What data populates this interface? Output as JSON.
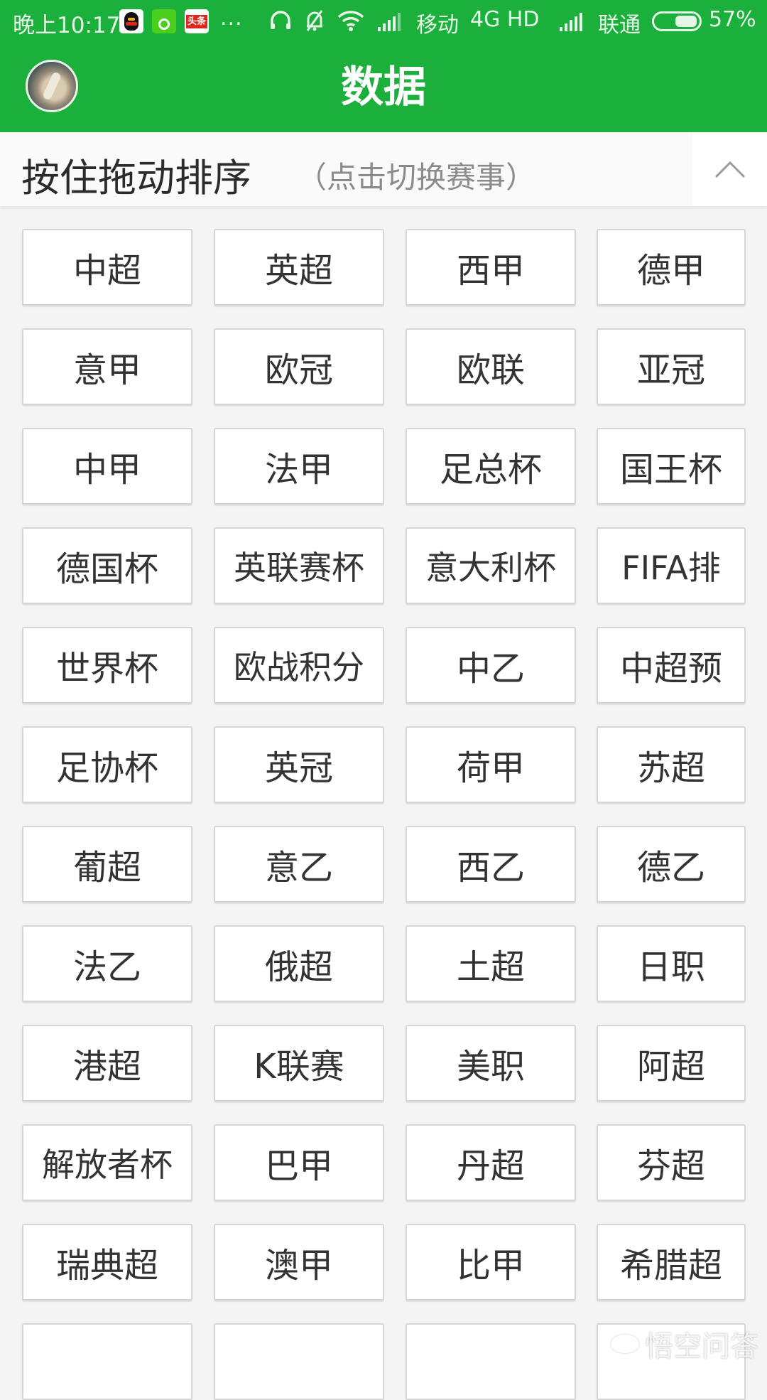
{
  "status_bar": {
    "time": "晚上10:17",
    "notification_icons": [
      "qq-icon",
      "sports-app-icon",
      "toutiao-icon"
    ],
    "toutiao_label": "头条",
    "more": "...",
    "carrier1": "移动",
    "network": "4G HD",
    "carrier2": "联通",
    "battery_percent": "57%",
    "battery_level": 0.57
  },
  "app_bar": {
    "title": "数据"
  },
  "sort_bar": {
    "title": "按住拖动排序",
    "hint": "（点击切换赛事）"
  },
  "competitions": [
    "中超",
    "英超",
    "西甲",
    "德甲",
    "意甲",
    "欧冠",
    "欧联",
    "亚冠",
    "中甲",
    "法甲",
    "足总杯",
    "国王杯",
    "德国杯",
    "英联赛杯",
    "意大利杯",
    "FIFA排",
    "世界杯",
    "欧战积分",
    "中乙",
    "中超预",
    "足协杯",
    "英冠",
    "荷甲",
    "苏超",
    "葡超",
    "意乙",
    "西乙",
    "德乙",
    "法乙",
    "俄超",
    "土超",
    "日职",
    "港超",
    "K联赛",
    "美职",
    "阿超",
    "解放者杯",
    "巴甲",
    "丹超",
    "芬超",
    "瑞典超",
    "澳甲",
    "比甲",
    "希腊超",
    "",
    "",
    "",
    ""
  ],
  "watermark": "悟空问答",
  "colors": {
    "brand_green": "#1bb03c",
    "background": "#f4f4f4",
    "text": "#333333"
  }
}
